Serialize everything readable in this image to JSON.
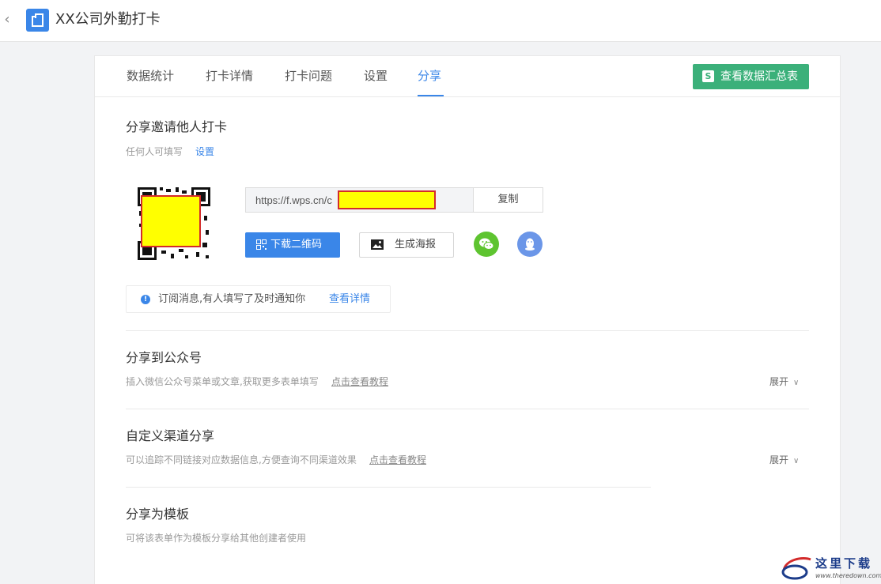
{
  "header": {
    "back_icon": "chevron-left-icon",
    "app_icon": "form-app-icon",
    "title": "XX公司外勤打卡"
  },
  "tabs": [
    {
      "label": "数据统计",
      "active": false
    },
    {
      "label": "打卡详情",
      "active": false
    },
    {
      "label": "打卡问题",
      "active": false
    },
    {
      "label": "设置",
      "active": false
    },
    {
      "label": "分享",
      "active": true
    }
  ],
  "summary_button": {
    "icon": "spreadsheet-s-icon",
    "icon_glyph": "S",
    "label": "查看数据汇总表"
  },
  "invite": {
    "title": "分享邀请他人打卡",
    "permission": "任何人可填写",
    "settings_link": "设置",
    "url": "https://f.wps.cn/c",
    "copy_label": "复制",
    "download_qr_label": "下载二维码",
    "poster_label": "生成海报"
  },
  "notice": {
    "icon_glyph": "!",
    "message": "订阅消息,有人填写了及时通知你",
    "link": "查看详情"
  },
  "sections": [
    {
      "title": "分享到公众号",
      "desc": "插入微信公众号菜单或文章,获取更多表单填写",
      "tutorial": "点击查看教程",
      "expand": "展开"
    },
    {
      "title": "自定义渠道分享",
      "desc": "可以追踪不同链接对应数据信息,方便查询不同渠道效果",
      "tutorial": "点击查看教程",
      "expand": "展开"
    },
    {
      "title": "分享为模板",
      "desc": "可将该表单作为模板分享给其他创建者使用"
    }
  ],
  "watermark": {
    "text": "这里下载",
    "url": "www.theredown.com"
  },
  "colors": {
    "accent": "#3a86e8",
    "green": "#3bb07a",
    "wechat": "#5ec430",
    "qq": "#6b96e8",
    "redaction": "#ffff00"
  }
}
